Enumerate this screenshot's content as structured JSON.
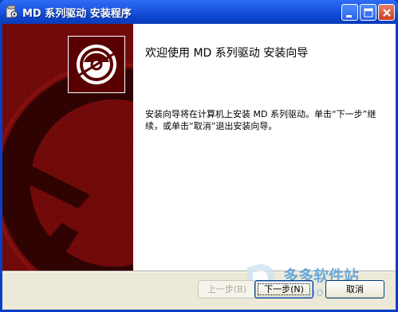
{
  "window": {
    "title": "MD  系列驱动  安装程序",
    "icon": "installer-icon",
    "controls": {
      "minimize": "minimize-icon",
      "maximize": "maximize-icon",
      "close": "close-icon"
    }
  },
  "banner": {
    "welcome_title": "欢迎使用 MD 系列驱动 安装向导",
    "description": "安装向导将在计算机上安装 MD 系列驱动。单击“下一步”继续，或单击“取消”退出安装向导。",
    "logo_icon": "disc-icon"
  },
  "buttons": {
    "back": "上一步(B)",
    "next": "下一步(N)",
    "cancel": "取消"
  },
  "watermark": {
    "text": "多多软件站",
    "domain": "ddooo.com"
  },
  "colors": {
    "titlebar": "#0b45cf",
    "side_panel": "#7a0b0b",
    "dialog_bg": "#ece9d8"
  }
}
